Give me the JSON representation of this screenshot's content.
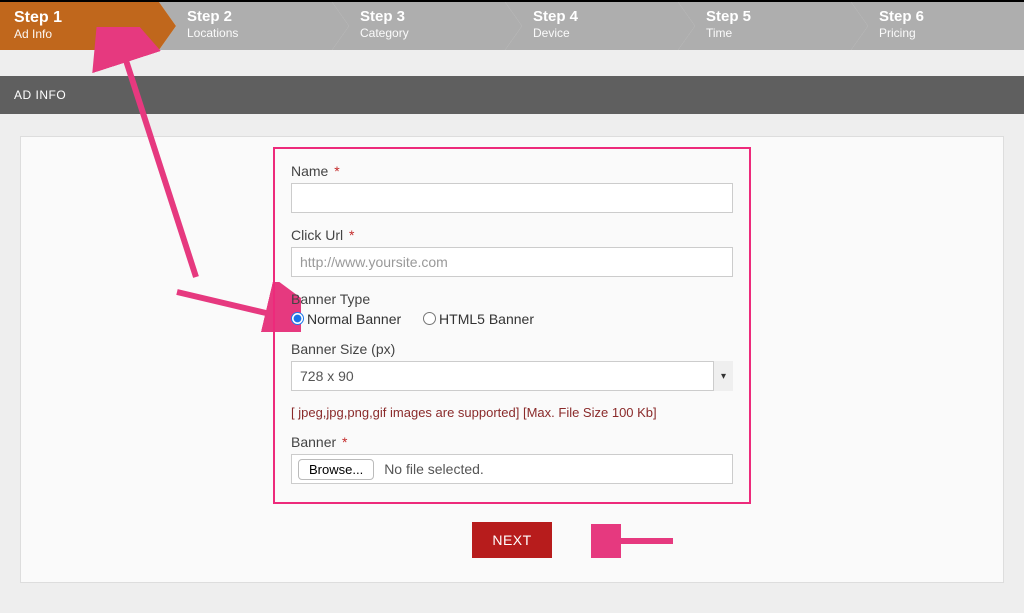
{
  "steps": [
    {
      "title": "Step 1",
      "sub": "Ad Info"
    },
    {
      "title": "Step 2",
      "sub": "Locations"
    },
    {
      "title": "Step 3",
      "sub": "Category"
    },
    {
      "title": "Step 4",
      "sub": "Device"
    },
    {
      "title": "Step 5",
      "sub": "Time"
    },
    {
      "title": "Step 6",
      "sub": "Pricing"
    }
  ],
  "section": {
    "title": "AD INFO"
  },
  "form": {
    "name_label": "Name",
    "clickurl_label": "Click Url",
    "clickurl_placeholder": "http://www.yoursite.com",
    "bannerType_label": "Banner Type",
    "bannerType_normal": "Normal Banner",
    "bannerType_html5": "HTML5 Banner",
    "bannerSize_label": "Banner Size (px)",
    "bannerSize_value": "728 x 90",
    "hint": "[ jpeg,jpg,png,gif images are supported] [Max. File Size 100 Kb]",
    "banner_label": "Banner",
    "browse_label": "Browse...",
    "file_status": "No file selected."
  },
  "actions": {
    "next": "NEXT"
  }
}
